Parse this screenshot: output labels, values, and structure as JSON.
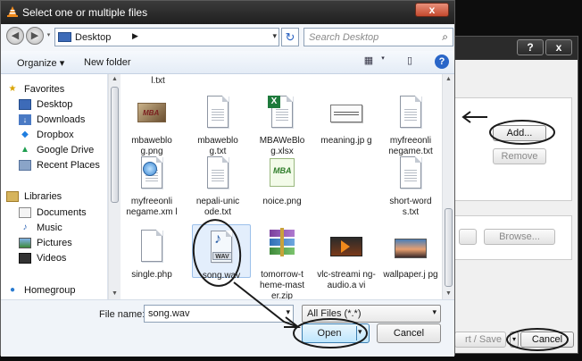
{
  "dialog": {
    "title": "Select one or multiple files",
    "close_label": "x"
  },
  "address": {
    "back_icon": "back-arrow-icon",
    "forward_icon": "forward-arrow-icon",
    "location": "Desktop",
    "search_placeholder": "Search Desktop"
  },
  "toolbar": {
    "organize_label": "Organize ▾",
    "new_folder_label": "New folder"
  },
  "sidebar": {
    "favorites_label": "Favorites",
    "favorites": [
      "Desktop",
      "Downloads",
      "Dropbox",
      "Google Drive",
      "Recent Places"
    ],
    "libraries_label": "Libraries",
    "libraries": [
      "Documents",
      "Music",
      "Pictures",
      "Videos"
    ],
    "homegroup_label": "Homegroup"
  },
  "files": {
    "partial_top": "l.txt",
    "items": [
      {
        "name": "mbaweblo g.png",
        "icon": "image-icon"
      },
      {
        "name": "mbaweblo g.txt",
        "icon": "text-file-icon"
      },
      {
        "name": "MBAWeBlo g.xlsx",
        "icon": "excel-icon"
      },
      {
        "name": "meaning.jp g",
        "icon": "image-icon"
      },
      {
        "name": "myfreeonli negame.txt",
        "icon": "text-file-icon"
      },
      {
        "name": "myfreeonli negame.xm l",
        "icon": "xml-icon"
      },
      {
        "name": "nepali-unic ode.txt",
        "icon": "text-file-icon"
      },
      {
        "name": "noice.png",
        "icon": "image-icon"
      },
      {
        "name": "short-word s.txt",
        "icon": "text-file-icon"
      },
      {
        "name": "single.php",
        "icon": "php-file-icon"
      },
      {
        "name": "song.wav",
        "icon": "wav-audio-icon",
        "selected": true
      },
      {
        "name": "tomorrow-t heme-mast er.zip",
        "icon": "zip-archive-icon"
      },
      {
        "name": "vlc-streami ng-audio.a vi",
        "icon": "video-icon"
      },
      {
        "name": "wallpaper.j pg",
        "icon": "image-icon"
      }
    ]
  },
  "bottom": {
    "file_name_label": "File name:",
    "file_name_value": "song.wav",
    "file_type_value": "All Files (*.*)",
    "open_label": "Open",
    "cancel_label": "Cancel"
  },
  "background_window": {
    "help_label": "?",
    "close_label": "x",
    "add_label": "Add...",
    "remove_label": "Remove",
    "browse_label": "Browse...",
    "convert_label": "rt / Save",
    "cancel_label": "Cancel"
  },
  "colors": {
    "title_bar": "#1f1f1f",
    "annotation": "#1a1a1a",
    "selection": "#e3eefc",
    "accent": "#2a66c8"
  }
}
